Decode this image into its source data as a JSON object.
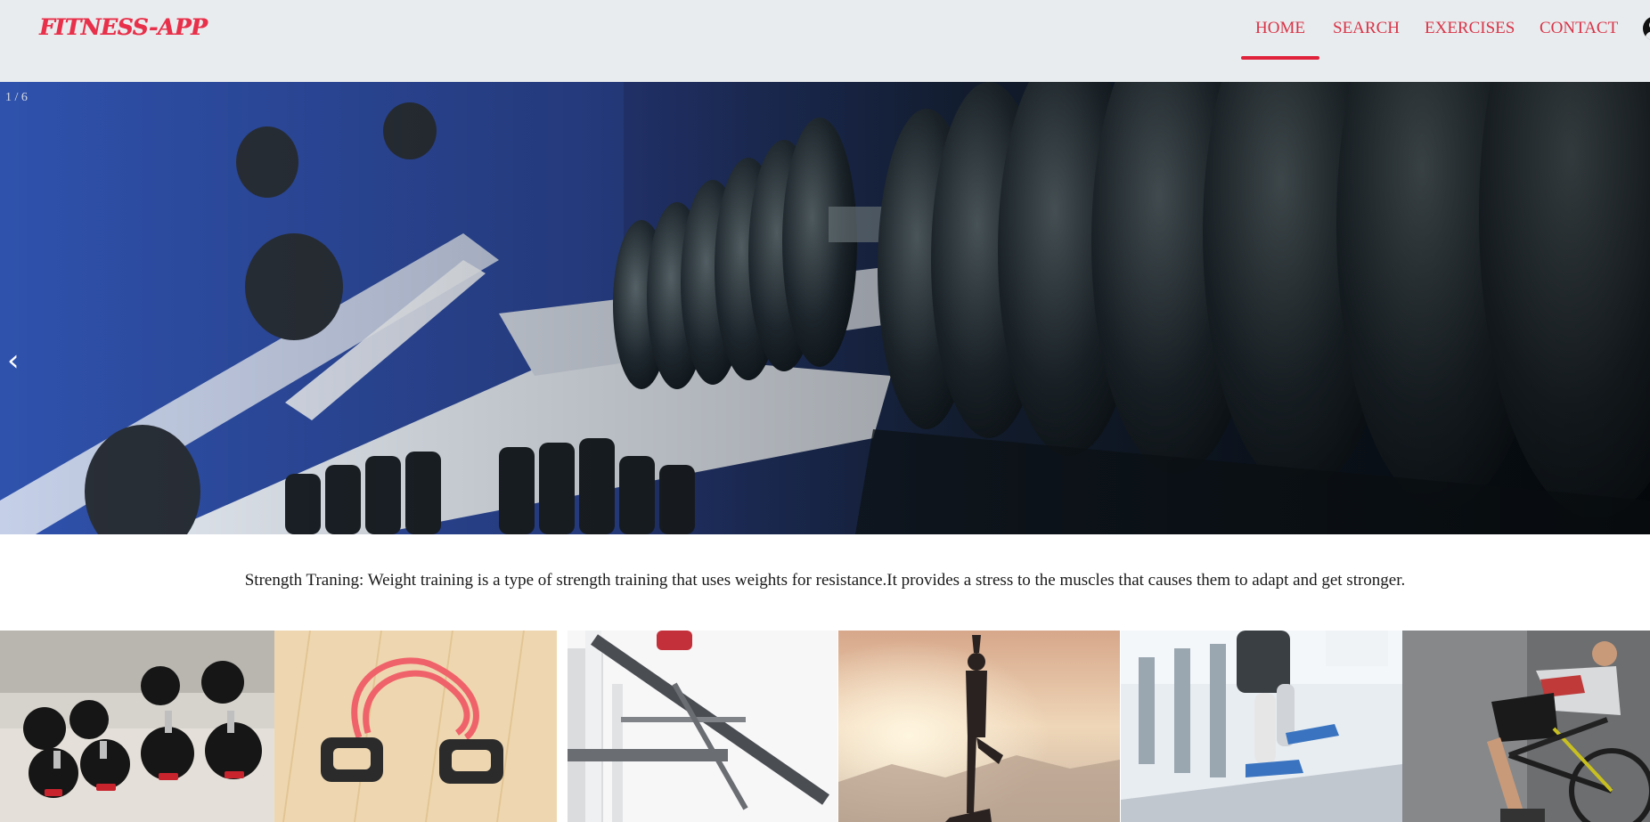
{
  "brand": {
    "logo_text": "FITNESS-APP",
    "accent_color": "#e8304a"
  },
  "nav": {
    "items": [
      {
        "label": "HOME",
        "active": true
      },
      {
        "label": "SEARCH",
        "active": false
      },
      {
        "label": "EXERCISES",
        "active": false
      },
      {
        "label": "CONTACT",
        "active": false
      }
    ],
    "user_icon": "user-circle-icon"
  },
  "hero": {
    "slide_counter": "1 / 6",
    "prev_icon": "chevron-left-icon",
    "image": "gym-dumbbell-rack-photo"
  },
  "description": {
    "text": "Strength Traning: Weight training is a type of strength training that uses weights for resistance.It provides a stress to the muscles that causes them to adapt and get stronger."
  },
  "gallery": {
    "tiles": [
      {
        "image": "dumbbells-photo"
      },
      {
        "image": "resistance-band-photo"
      },
      {
        "image": "pull-up-bar-photo"
      },
      {
        "image": "yoga-silhouette-photo"
      },
      {
        "image": "treadmill-runner-photo"
      },
      {
        "image": "cyclist-photo"
      }
    ]
  }
}
